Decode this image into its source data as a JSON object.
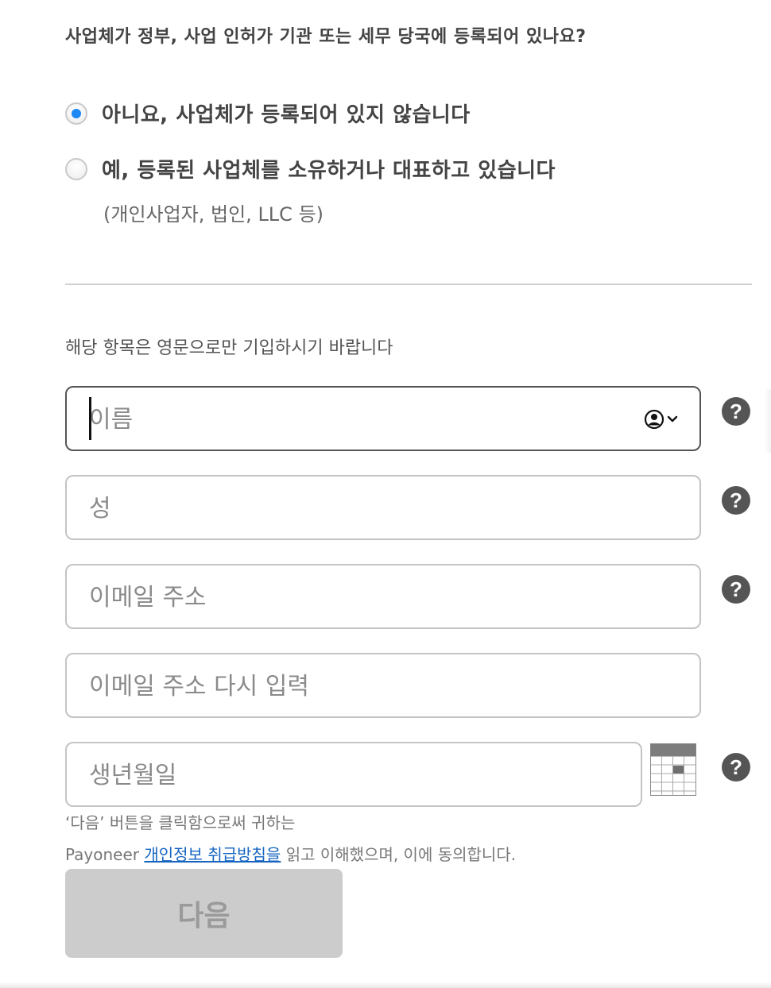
{
  "registration": {
    "question": "사업체가 정부, 사업 인허가 기관 또는 세무 당국에 등록되어 있나요?",
    "options": [
      {
        "label": "아니요, 사업체가 등록되어 있지 않습니다",
        "selected": true
      },
      {
        "label": "예, 등록된 사업체를 소유하거나 대표하고 있습니다",
        "sublabel": "(개인사업자, 법인, LLC 등)",
        "selected": false
      }
    ]
  },
  "form": {
    "instruction": "해당 항목은 영문으로만 기입하시기 바랍니다",
    "first_name": {
      "placeholder": "이름",
      "value": ""
    },
    "last_name": {
      "placeholder": "성",
      "value": ""
    },
    "email": {
      "placeholder": "이메일 주소",
      "value": ""
    },
    "email_confirm": {
      "placeholder": "이메일 주소 다시 입력",
      "value": ""
    },
    "birth_date": {
      "placeholder": "생년월일",
      "value": ""
    },
    "help_glyph": "?"
  },
  "consent": {
    "line1": "‘다음’ 버튼을 클릭함으로써 귀하는",
    "brand": "Payoneer",
    "link": "개인정보 취급방침을",
    "suffix": "읽고 이해했으며, 이에 동의합니다."
  },
  "actions": {
    "next_label": "다음"
  },
  "icons": {
    "autofill": "person-circle-icon",
    "calendar": "calendar-icon",
    "help": "question-circle-icon"
  },
  "colors": {
    "radio_selected": "#1e88f5",
    "link": "#1565c0",
    "button_disabled_bg": "#cccccc",
    "help_icon_bg": "#555555"
  }
}
